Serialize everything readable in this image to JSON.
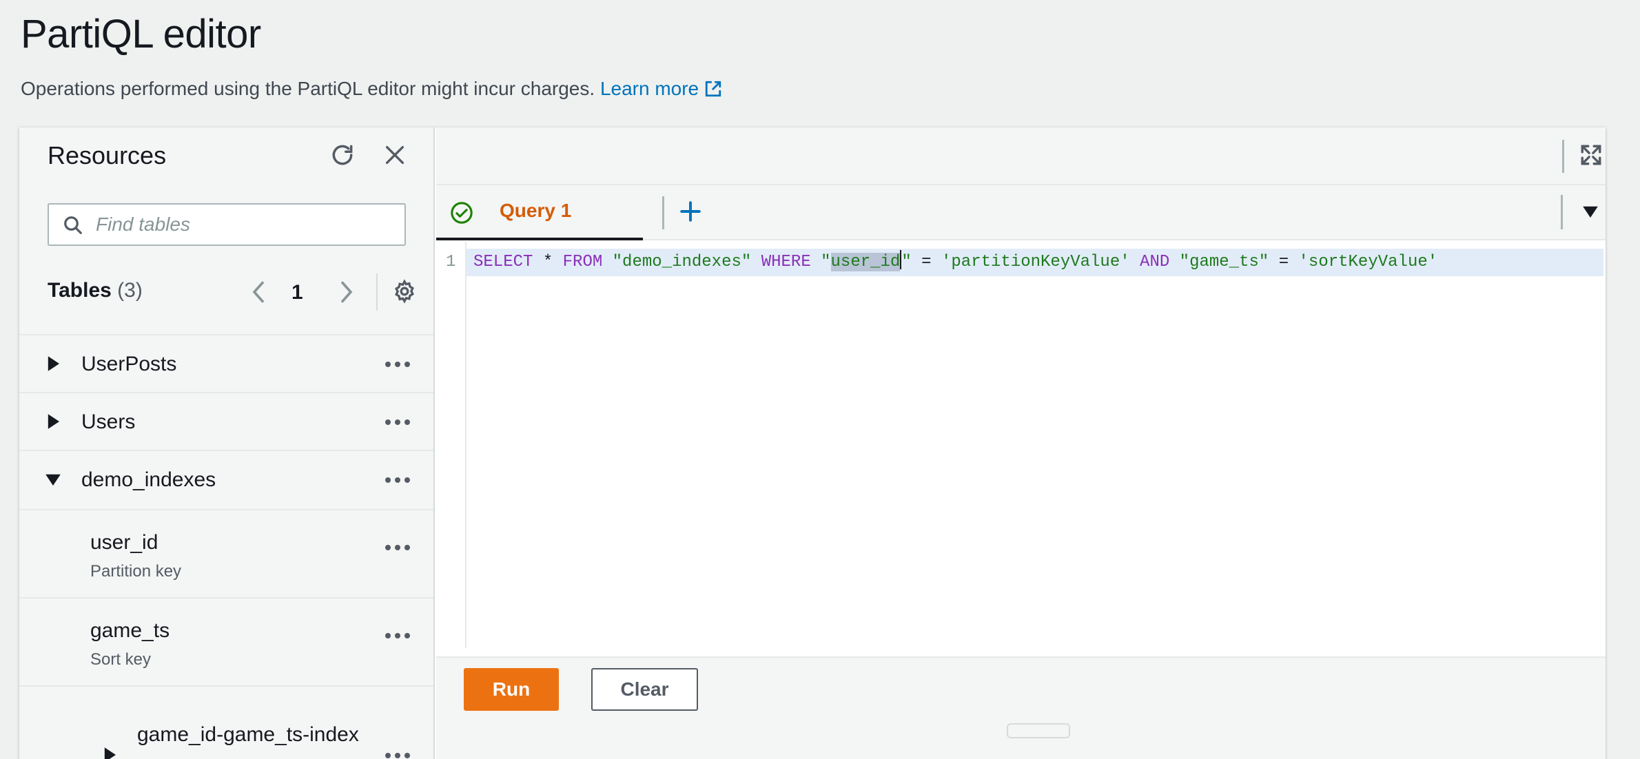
{
  "page": {
    "title": "PartiQL editor",
    "subtitle": "Operations performed using the PartiQL editor might incur charges.",
    "learn_more": "Learn more"
  },
  "resources": {
    "title": "Resources",
    "search_placeholder": "Find tables",
    "tables_label": "Tables",
    "tables_count": "(3)",
    "page_number": "1",
    "items": [
      {
        "label": "UserPosts"
      },
      {
        "label": "Users"
      },
      {
        "label": "demo_indexes"
      },
      {
        "label": "user_id",
        "sub": "Partition key"
      },
      {
        "label": "game_ts",
        "sub": "Sort key"
      },
      {
        "label": "game_id-game_ts-index"
      }
    ]
  },
  "editor": {
    "tab_label": "Query 1",
    "line_number": "1",
    "code": {
      "t1": "SELECT",
      "t2": " * ",
      "t3": "FROM",
      "t4": " ",
      "t5": "\"demo_indexes\"",
      "t6": " ",
      "t7": "WHERE",
      "t8": " ",
      "t9": "\"",
      "t10": "user_id",
      "t11": "\"",
      "t12": " = ",
      "t13": "'partitionKeyValue'",
      "t14": " ",
      "t15": "AND",
      "t16": " ",
      "t17": "\"game_ts\"",
      "t18": " = ",
      "t19": "'sortKeyValue'"
    },
    "run_label": "Run",
    "clear_label": "Clear"
  },
  "colors": {
    "accent": "#ec7211",
    "tab_active": "#d45b07",
    "link": "#0073bb",
    "keyword": "#8a2fb8",
    "string": "#1d7a1d"
  },
  "icons": [
    "refresh-icon",
    "close-icon",
    "search-icon",
    "chevron-left-icon",
    "chevron-right-icon",
    "gear-icon",
    "caret-right-icon",
    "caret-down-icon",
    "more-icon",
    "fullscreen-icon",
    "check-circle-icon",
    "plus-icon",
    "external-link-icon"
  ]
}
